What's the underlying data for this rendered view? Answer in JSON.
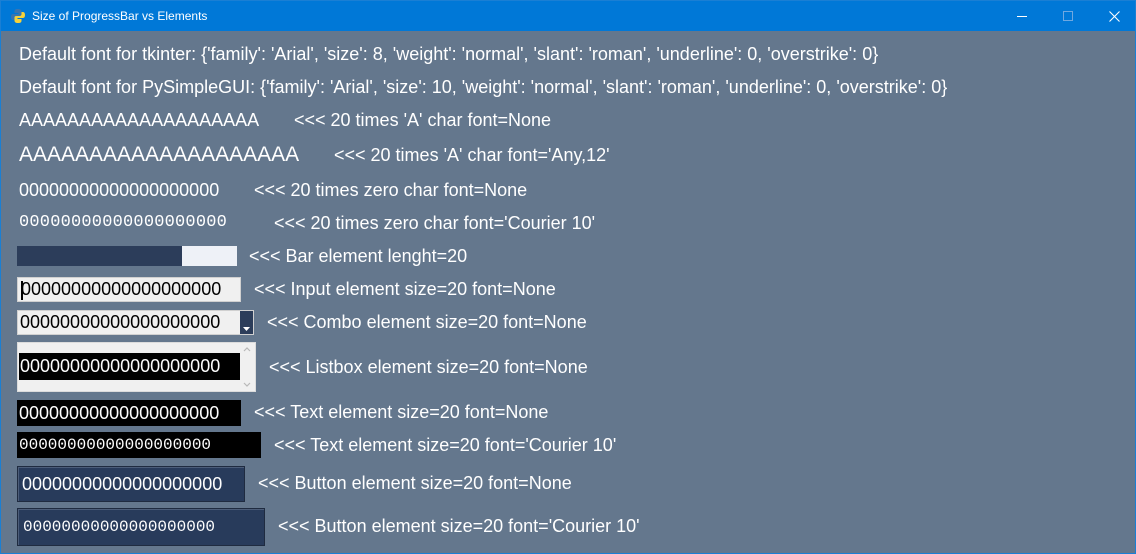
{
  "window": {
    "title": "Size of ProgressBar vs Elements",
    "accent_color": "#0078d7",
    "background_color": "#64778d"
  },
  "rows": {
    "tk_font": "Default font for tkinter: {'family': 'Arial', 'size': 8, 'weight': 'normal', 'slant': 'roman', 'underline': 0, 'overstrike': 0}",
    "psg_font": "Default font for PySimpleGUI: {'family': 'Arial', 'size': 10, 'weight': 'normal', 'slant': 'roman', 'underline': 0, 'overstrike': 0}",
    "a_default": {
      "sample": "AAAAAAAAAAAAAAAAAAAA",
      "label": "<<< 20 times 'A' char font=None"
    },
    "a_any12": {
      "sample": "AAAAAAAAAAAAAAAAAAAA",
      "label": "<<< 20 times 'A' char font='Any,12'"
    },
    "zero_default": {
      "sample": "00000000000000000000",
      "label": "<<< 20 times zero char font=None"
    },
    "zero_courier": {
      "sample": "00000000000000000000",
      "label": "<<< 20 times zero char font='Courier 10'"
    },
    "bar": {
      "progress": 0.75,
      "label": "<<< Bar element lenght=20",
      "fill_color": "#2c3d5a",
      "track_color": "#eef1f7"
    },
    "input": {
      "value": "00000000000000000000",
      "label": "<<< Input element size=20 font=None"
    },
    "combo": {
      "value": "00000000000000000000",
      "label": "<<< Combo element size=20 font=None"
    },
    "listbox": {
      "item": "00000000000000000000",
      "label": "<<< Listbox element size=20 font=None"
    },
    "text_default": {
      "value": "00000000000000000000",
      "label": "<<< Text element size=20 font=None"
    },
    "text_courier": {
      "value": "00000000000000000000",
      "label": "<<< Text element size=20 font='Courier 10'"
    },
    "button_default": {
      "value": "00000000000000000000",
      "label": "<<< Button element size=20 font=None"
    },
    "button_courier": {
      "value": "00000000000000000000",
      "label": "<<< Button element size=20 font='Courier 10'"
    }
  }
}
